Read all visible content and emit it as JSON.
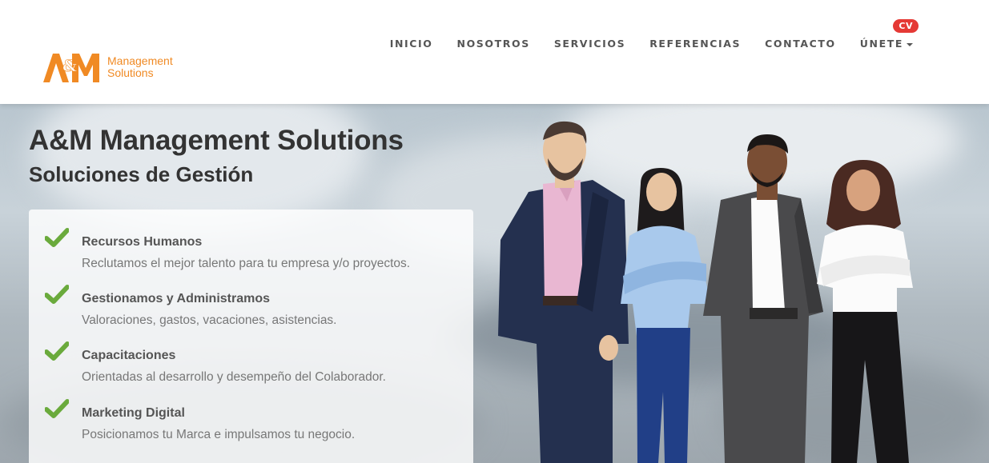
{
  "logo": {
    "mark": "A&M",
    "line1": "Management",
    "line2": "Solutions"
  },
  "nav": {
    "items": [
      {
        "label": "INICIO"
      },
      {
        "label": "NOSOTROS"
      },
      {
        "label": "SERVICIOS"
      },
      {
        "label": "REFERENCIAS"
      },
      {
        "label": "CONTACTO"
      },
      {
        "label": "ÚNETE"
      }
    ],
    "badge": "CV"
  },
  "hero": {
    "title": "A&M Management Solutions",
    "subtitle": "Soluciones de Gestión",
    "features": [
      {
        "title": "Recursos Humanos",
        "desc": "Reclutamos el mejor talento para tu empresa y/o proyectos."
      },
      {
        "title": "Gestionamos y Administramos",
        "desc": "Valoraciones, gastos, vacaciones, asistencias."
      },
      {
        "title": "Capacitaciones",
        "desc": "Orientadas al desarrollo y desempeño del Colaborador."
      },
      {
        "title": "Marketing Digital",
        "desc": "Posicionamos tu Marca e impulsamos tu negocio."
      }
    ]
  },
  "colors": {
    "accent": "#f08a24",
    "check": "#6aaa3c",
    "badge": "#e53935"
  },
  "icons": {
    "feature": "check-icon",
    "dropdown": "caret-down-icon"
  }
}
